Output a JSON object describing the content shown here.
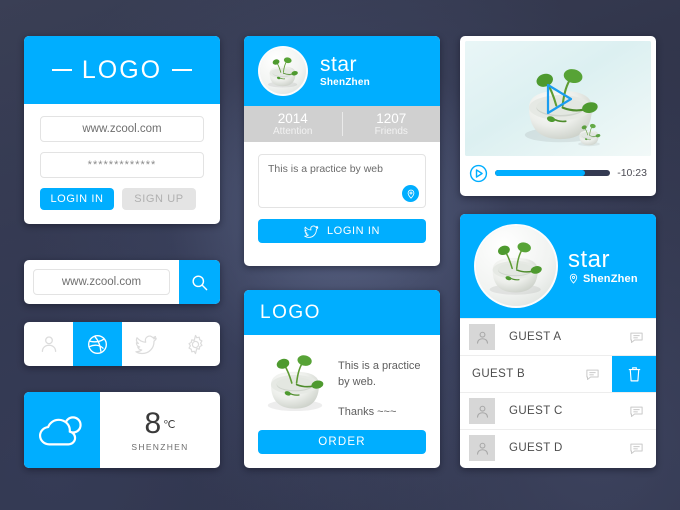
{
  "theme": {
    "accent": "#00aeff",
    "background": "#32364a",
    "muted_grey": "#d0d0d0"
  },
  "login_card": {
    "logo": "LOGO",
    "username_value": "www.zcool.com",
    "password_value": "*************",
    "login_button": "LOGIN IN",
    "signup_button": "SIGN UP"
  },
  "search_card": {
    "input_value": "www.zcool.com",
    "input_placeholder": "www.zcool.com",
    "search_icon": "search-icon"
  },
  "tabbar": {
    "tabs": [
      {
        "icon": "user-icon",
        "active": false
      },
      {
        "icon": "dribbble-icon",
        "active": true
      },
      {
        "icon": "twitter-icon",
        "active": false
      },
      {
        "icon": "gear-icon",
        "active": false
      }
    ]
  },
  "weather_card": {
    "icon": "cloud-sun-icon",
    "temperature": "8",
    "unit": "℃",
    "city": "SHENZHEN"
  },
  "profile_card": {
    "avatar": "plant-bowl-avatar",
    "name": "star",
    "city": "ShenZhen",
    "stats": [
      {
        "value": "2014",
        "label": "Attention"
      },
      {
        "value": "1207",
        "label": "Friends"
      }
    ],
    "textarea_value": "This is a practice by web",
    "location_button_icon": "location-pin-icon",
    "login_button": "LOGIN IN",
    "login_button_icon": "twitter-icon"
  },
  "product_card": {
    "logo": "LOGO",
    "image": "plant-bowl-image",
    "description_line1": "This is a practice",
    "description_line2": "by web.",
    "thanks": "Thanks ~~~",
    "order_button": "ORDER"
  },
  "video_card": {
    "poster": "plant-bowl-photo",
    "overlay_play_icon": "play-triangle-icon",
    "play_button_icon": "play-circle-icon",
    "progress_percent": 78,
    "time_remaining": "-10:23"
  },
  "guest_card": {
    "avatar": "plant-bowl-avatar",
    "name": "star",
    "city": "ShenZhen",
    "city_icon": "location-pin-icon",
    "rows": [
      {
        "name": "GUEST A",
        "swiped": false
      },
      {
        "name": "GUEST B",
        "swiped": true
      },
      {
        "name": "GUEST C",
        "swiped": false
      },
      {
        "name": "GUEST D",
        "swiped": false
      }
    ],
    "delete_icon": "trash-icon",
    "chat_icon": "chat-bubble-icon",
    "avatar_icon": "user-icon"
  }
}
